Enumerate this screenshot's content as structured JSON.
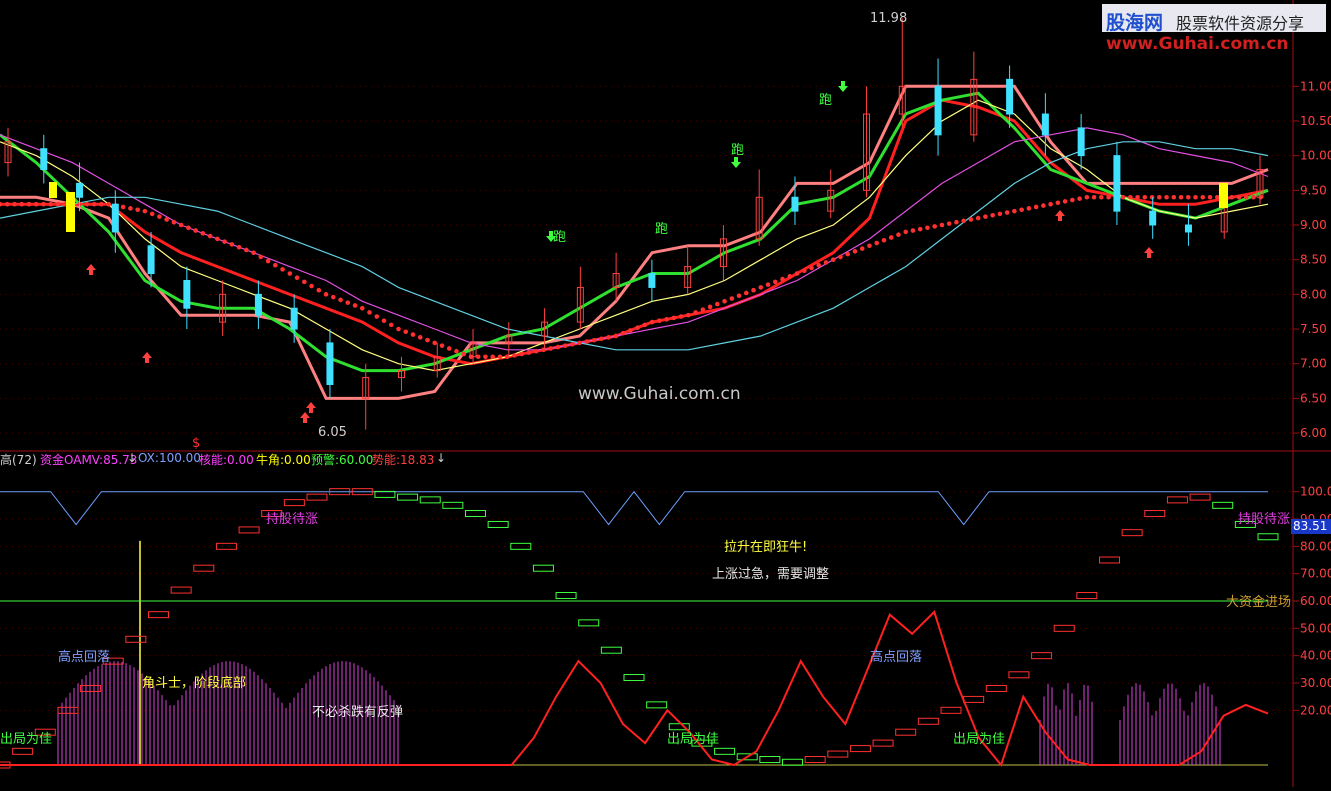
{
  "watermark": {
    "logo_cn": "股海网",
    "logo_tag": "股票软件资源分享",
    "logo_url": "www.Guhai.com.cn",
    "center": "www.Guhai.com.cn"
  },
  "main_chart": {
    "high_label": "11.98",
    "low_label": "6.05",
    "dollar_marker": "$",
    "run_signal": "跑",
    "yticks": [
      "11.00",
      "10.50",
      "10.00",
      "9.50",
      "9.00",
      "8.50",
      "8.00",
      "7.50",
      "7.00",
      "6.50",
      "6.00"
    ]
  },
  "indicator": {
    "header": [
      {
        "text": "高(72)",
        "color": "#d0d0d0"
      },
      {
        "text": "资金OAMV:85.73",
        "color": "#ff40ff"
      },
      {
        "text": "↓",
        "color": "#d0d0d0"
      },
      {
        "text": "OX:100.00",
        "color": "#80a0ff"
      },
      {
        "text": "核能:0.00",
        "color": "#ff40ff"
      },
      {
        "text": "牛角:0.00",
        "color": "#ffff00"
      },
      {
        "text": "预警:60.00",
        "color": "#40ff40"
      },
      {
        "text": "势能:18.83",
        "color": "#ff4040"
      },
      {
        "text": "↓",
        "color": "#d0d0d0"
      }
    ],
    "yticks": [
      "100.00",
      "90.00",
      "80.00",
      "70.00",
      "60.00",
      "50.00",
      "40.00",
      "30.00",
      "20.00"
    ],
    "current_value": "83.51",
    "annotations": {
      "hold_1": "持股待涨",
      "hold_2": "持股待涨",
      "rally": "拉升在即狂牛!",
      "too_fast": "上涨过急，需要调整",
      "big_money": "大资金进场",
      "high_fall_1": "高点回落",
      "high_fall_2": "高点回落",
      "fighter": "角斗士，阶段底部",
      "no_chase": "不必杀跌有反弹",
      "exit_1": "出局为佳",
      "exit_2": "出局为佳",
      "exit_3": "出局为佳"
    }
  },
  "chart_data": {
    "type": "line",
    "title": "",
    "price_panel": {
      "ylim": [
        5.9,
        12.1
      ],
      "price_high": 11.98,
      "price_low": 6.05,
      "series": [
        {
          "name": "",
          "color": "#ff8080",
          "values": [
            9.4,
            9.4,
            9.3,
            9.1,
            8.3,
            7.7,
            7.7,
            7.7,
            7.6,
            6.5,
            6.5,
            6.5,
            6.6,
            7.3,
            7.3,
            7.3,
            7.4,
            7.9,
            8.6,
            8.7,
            8.7,
            8.9,
            9.6,
            9.6,
            9.9,
            11.0,
            11.0,
            11.0,
            11.0,
            10.2,
            9.6,
            9.6,
            9.6,
            9.6,
            9.6,
            9.8
          ]
        },
        {
          "name": "",
          "color": "#ff2020",
          "values": [
            9.3,
            9.3,
            9.3,
            9.3,
            8.9,
            8.6,
            8.4,
            8.2,
            8.0,
            7.8,
            7.6,
            7.3,
            7.1,
            7.0,
            7.1,
            7.2,
            7.3,
            7.4,
            7.6,
            7.7,
            7.8,
            8.0,
            8.3,
            8.6,
            9.1,
            10.5,
            10.8,
            10.7,
            10.5,
            9.9,
            9.5,
            9.4,
            9.3,
            9.3,
            9.4,
            9.5
          ]
        },
        {
          "name": "",
          "color": "#30e030",
          "values": [
            10.3,
            9.9,
            9.4,
            8.9,
            8.2,
            7.9,
            7.8,
            7.8,
            7.5,
            7.1,
            6.9,
            6.9,
            7.0,
            7.2,
            7.4,
            7.5,
            7.8,
            8.1,
            8.3,
            8.3,
            8.6,
            8.8,
            9.3,
            9.4,
            9.7,
            10.6,
            10.8,
            10.9,
            10.4,
            9.8,
            9.6,
            9.4,
            9.2,
            9.1,
            9.3,
            9.5
          ]
        },
        {
          "name": "",
          "color": "#ffff80",
          "values": [
            10.2,
            10.0,
            9.7,
            9.3,
            8.8,
            8.4,
            8.2,
            8.0,
            7.8,
            7.5,
            7.2,
            7.0,
            6.9,
            7.0,
            7.1,
            7.3,
            7.5,
            7.7,
            7.9,
            8.0,
            8.2,
            8.5,
            8.8,
            9.0,
            9.4,
            10.0,
            10.5,
            10.8,
            10.6,
            10.1,
            9.8,
            9.4,
            9.2,
            9.1,
            9.2,
            9.3
          ]
        },
        {
          "name": "",
          "color": "#e050e0",
          "values": [
            10.3,
            10.1,
            9.9,
            9.6,
            9.3,
            9.0,
            8.8,
            8.6,
            8.4,
            8.2,
            7.9,
            7.7,
            7.5,
            7.3,
            7.2,
            7.2,
            7.3,
            7.4,
            7.5,
            7.6,
            7.8,
            8.0,
            8.2,
            8.5,
            8.8,
            9.2,
            9.6,
            9.9,
            10.2,
            10.3,
            10.4,
            10.3,
            10.1,
            10.0,
            9.9,
            9.7
          ]
        },
        {
          "name": "",
          "color": "#60d0e0",
          "values": [
            9.1,
            9.2,
            9.3,
            9.4,
            9.4,
            9.3,
            9.2,
            9.0,
            8.8,
            8.6,
            8.4,
            8.1,
            7.9,
            7.7,
            7.5,
            7.4,
            7.3,
            7.2,
            7.2,
            7.2,
            7.3,
            7.4,
            7.6,
            7.8,
            8.1,
            8.4,
            8.8,
            9.2,
            9.6,
            9.9,
            10.1,
            10.2,
            10.2,
            10.1,
            10.1,
            10.0
          ]
        },
        {
          "name": "",
          "color": "#ff3030",
          "dotted": true,
          "values": [
            9.3,
            9.3,
            9.3,
            9.3,
            9.2,
            9.0,
            8.8,
            8.6,
            8.3,
            8.0,
            7.8,
            7.5,
            7.3,
            7.1,
            7.1,
            7.2,
            7.3,
            7.4,
            7.6,
            7.7,
            7.9,
            8.1,
            8.3,
            8.5,
            8.7,
            8.9,
            9.0,
            9.1,
            9.2,
            9.3,
            9.4,
            9.4,
            9.4,
            9.4,
            9.4,
            9.4
          ]
        }
      ],
      "candles": [
        {
          "o": 9.9,
          "c": 10.2,
          "h": 10.4,
          "l": 9.7
        },
        {
          "o": 10.1,
          "c": 9.8,
          "h": 10.3,
          "l": 9.6
        },
        {
          "o": 9.6,
          "c": 9.4,
          "h": 9.9,
          "l": 9.2
        },
        {
          "o": 9.3,
          "c": 8.9,
          "h": 9.5,
          "l": 8.6
        },
        {
          "o": 8.7,
          "c": 8.3,
          "h": 8.9,
          "l": 8.1
        },
        {
          "o": 8.2,
          "c": 7.8,
          "h": 8.4,
          "l": 7.5
        },
        {
          "o": 7.6,
          "c": 8.0,
          "h": 8.2,
          "l": 7.4
        },
        {
          "o": 8.0,
          "c": 7.7,
          "h": 8.2,
          "l": 7.5
        },
        {
          "o": 7.8,
          "c": 7.5,
          "h": 8.0,
          "l": 7.3
        },
        {
          "o": 7.3,
          "c": 6.7,
          "h": 7.5,
          "l": 6.5
        },
        {
          "o": 6.5,
          "c": 6.8,
          "h": 7.0,
          "l": 6.05
        },
        {
          "o": 6.8,
          "c": 6.9,
          "h": 7.1,
          "l": 6.6
        },
        {
          "o": 6.9,
          "c": 7.1,
          "h": 7.3,
          "l": 6.8
        },
        {
          "o": 7.1,
          "c": 7.3,
          "h": 7.5,
          "l": 7.0
        },
        {
          "o": 7.3,
          "c": 7.4,
          "h": 7.6,
          "l": 7.1
        },
        {
          "o": 7.4,
          "c": 7.6,
          "h": 7.8,
          "l": 7.2
        },
        {
          "o": 7.6,
          "c": 8.1,
          "h": 8.4,
          "l": 7.5
        },
        {
          "o": 8.1,
          "c": 8.3,
          "h": 8.6,
          "l": 7.9
        },
        {
          "o": 8.3,
          "c": 8.1,
          "h": 8.5,
          "l": 7.9
        },
        {
          "o": 8.1,
          "c": 8.4,
          "h": 8.7,
          "l": 8.0
        },
        {
          "o": 8.4,
          "c": 8.8,
          "h": 9.0,
          "l": 8.2
        },
        {
          "o": 8.8,
          "c": 9.4,
          "h": 9.8,
          "l": 8.7
        },
        {
          "o": 9.4,
          "c": 9.2,
          "h": 9.7,
          "l": 9.0
        },
        {
          "o": 9.2,
          "c": 9.5,
          "h": 9.8,
          "l": 9.1
        },
        {
          "o": 9.5,
          "c": 10.6,
          "h": 11.0,
          "l": 9.4
        },
        {
          "o": 10.6,
          "c": 11.0,
          "h": 11.98,
          "l": 10.4
        },
        {
          "o": 11.0,
          "c": 10.3,
          "h": 11.4,
          "l": 10.0
        },
        {
          "o": 10.3,
          "c": 11.1,
          "h": 11.5,
          "l": 10.2
        },
        {
          "o": 11.1,
          "c": 10.6,
          "h": 11.3,
          "l": 10.4
        },
        {
          "o": 10.6,
          "c": 10.3,
          "h": 10.9,
          "l": 10.0
        },
        {
          "o": 10.4,
          "c": 10.0,
          "h": 10.6,
          "l": 9.8
        },
        {
          "o": 10.0,
          "c": 9.2,
          "h": 10.2,
          "l": 9.0
        },
        {
          "o": 9.2,
          "c": 9.0,
          "h": 9.4,
          "l": 8.8
        },
        {
          "o": 9.0,
          "c": 8.9,
          "h": 9.3,
          "l": 8.7
        },
        {
          "o": 8.9,
          "c": 9.4,
          "h": 9.6,
          "l": 8.8
        },
        {
          "o": 9.4,
          "c": 9.8,
          "h": 10.0,
          "l": 9.3
        }
      ]
    },
    "indicator_panel": {
      "ylim": [
        0,
        105
      ],
      "series": [
        {
          "name": "OX",
          "color": "#6aa0ff",
          "values": [
            100,
            100,
            100,
            88,
            100,
            100,
            100,
            100,
            100,
            100,
            100,
            100,
            100,
            100,
            100,
            100,
            100,
            100,
            100,
            100,
            100,
            100,
            100,
            100,
            88,
            100,
            88,
            100,
            100,
            100,
            100,
            100,
            100,
            100,
            100,
            100,
            100,
            100,
            88,
            100,
            100,
            100,
            100,
            100,
            100,
            100,
            100,
            100,
            100,
            100,
            100
          ]
        },
        {
          "name": "预警",
          "color": "#40ff40",
          "values": [
            60,
            60,
            60,
            60,
            60,
            60,
            60,
            60,
            60,
            60,
            60,
            60,
            60,
            60,
            60,
            60,
            60,
            60,
            60,
            60,
            60,
            60,
            60,
            60,
            60,
            60,
            60,
            60,
            60,
            60,
            60,
            60,
            60,
            60,
            60,
            60,
            60,
            60,
            60,
            60,
            60,
            60,
            60,
            60,
            60,
            60,
            60,
            60,
            60,
            60,
            60
          ]
        },
        {
          "name": "资金OAMV",
          "color": "#ff40ff",
          "values": [
            0,
            5,
            12,
            20,
            28,
            38,
            46,
            55,
            64,
            72,
            80,
            86,
            92,
            96,
            98,
            100,
            100,
            99,
            98,
            97,
            95,
            92,
            88,
            80,
            72,
            62,
            52,
            42,
            32,
            22,
            14,
            8,
            5,
            3,
            2,
            1,
            2,
            4,
            6,
            8,
            12,
            16,
            20,
            24,
            28,
            33,
            40,
            50,
            62,
            75,
            85,
            92,
            97,
            98,
            95,
            88,
            83.5
          ]
        },
        {
          "name": "势能",
          "color": "#ff2020",
          "values": [
            0,
            0,
            0,
            0,
            0,
            0,
            0,
            0,
            0,
            0,
            0,
            0,
            0,
            0,
            0,
            0,
            0,
            0,
            0,
            0,
            0,
            0,
            0,
            0,
            10,
            25,
            38,
            30,
            15,
            8,
            20,
            12,
            2,
            0,
            5,
            20,
            38,
            25,
            15,
            35,
            55,
            48,
            56,
            30,
            10,
            0,
            25,
            12,
            2,
            0,
            0,
            0,
            0,
            0,
            5,
            18,
            22,
            18.8
          ]
        }
      ]
    }
  }
}
